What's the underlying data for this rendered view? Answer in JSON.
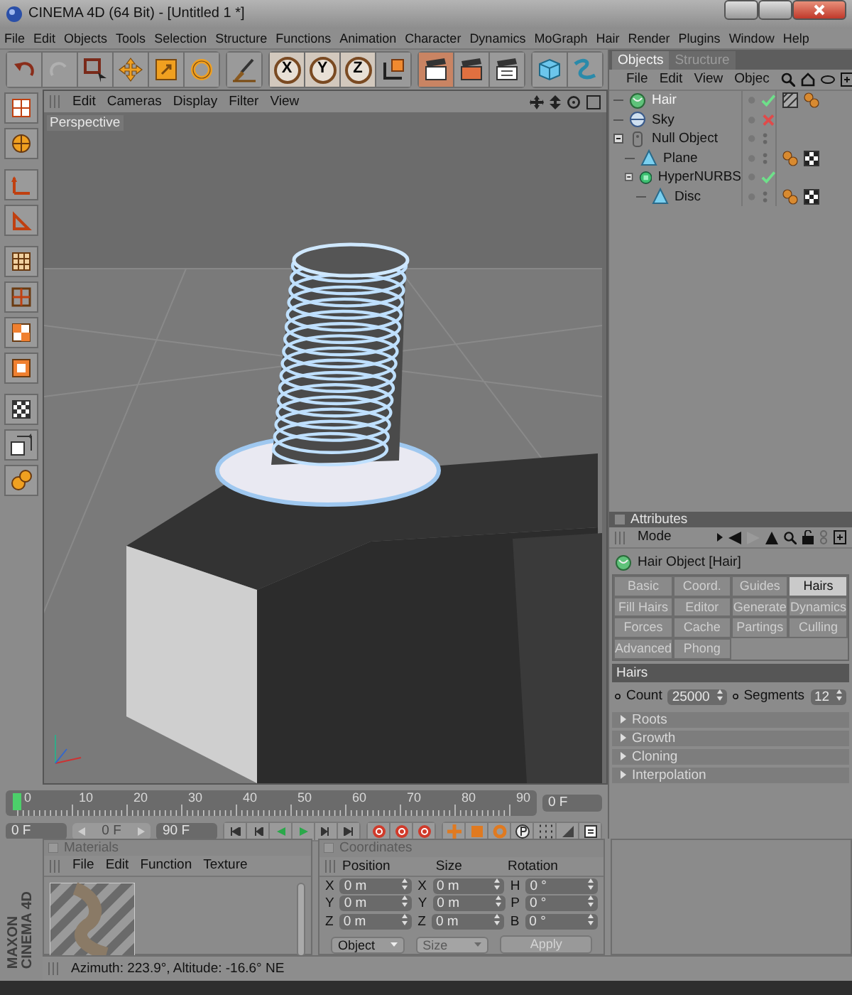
{
  "window": {
    "title": "CINEMA 4D (64 Bit) - [Untitled 1 *]"
  },
  "menu": [
    "File",
    "Edit",
    "Objects",
    "Tools",
    "Selection",
    "Structure",
    "Functions",
    "Animation",
    "Character",
    "Dynamics",
    "MoGraph",
    "Hair",
    "Render",
    "Plugins",
    "Window",
    "Help"
  ],
  "axis_buttons": [
    {
      "label": "X",
      "on": true
    },
    {
      "label": "Y",
      "on": true
    },
    {
      "label": "Z",
      "on": true
    }
  ],
  "viewport": {
    "menu": [
      "Edit",
      "Cameras",
      "Display",
      "Filter",
      "View"
    ],
    "camera": "Perspective"
  },
  "objects": {
    "tabs": [
      {
        "label": "Objects",
        "selected": true
      },
      {
        "label": "Structure",
        "selected": false
      }
    ],
    "menu": [
      "File",
      "Edit",
      "View",
      "Objec"
    ],
    "tree": [
      {
        "name": "Hair",
        "kind": "hair",
        "selected": true,
        "enabled": true,
        "tags": [
          {
            "kind": "hair-material"
          },
          {
            "kind": "phong"
          }
        ]
      },
      {
        "name": "Sky",
        "kind": "sky",
        "selected": false,
        "enabled": false
      },
      {
        "name": "Null Object",
        "kind": "null",
        "selected": false,
        "expanded": true,
        "children": [
          {
            "name": "Plane",
            "kind": "polygon",
            "selected": false,
            "tags": [
              {
                "kind": "phong"
              },
              {
                "kind": "checker"
              }
            ]
          },
          {
            "name": "HyperNURBS",
            "kind": "nurbs",
            "selected": false,
            "enabled": true,
            "expanded": true,
            "children": [
              {
                "name": "Disc",
                "kind": "polygon",
                "selected": false,
                "tags": [
                  {
                    "kind": "phong"
                  },
                  {
                    "kind": "checker"
                  }
                ]
              }
            ]
          }
        ]
      }
    ]
  },
  "attributes": {
    "title": "Attributes",
    "mode": "Mode",
    "object": "Hair Object [Hair]",
    "tabs": [
      {
        "label": "Basic",
        "selected": false
      },
      {
        "label": "Coord.",
        "selected": false
      },
      {
        "label": "Guides",
        "selected": false
      },
      {
        "label": "Hairs",
        "selected": true
      },
      {
        "label": "Fill Hairs",
        "selected": false
      },
      {
        "label": "Editor",
        "selected": false
      },
      {
        "label": "Generate",
        "selected": false
      },
      {
        "label": "Dynamics",
        "selected": false
      },
      {
        "label": "Forces",
        "selected": false
      },
      {
        "label": "Cache",
        "selected": false
      },
      {
        "label": "Partings",
        "selected": false
      },
      {
        "label": "Culling",
        "selected": false
      },
      {
        "label": "Advanced",
        "selected": false
      },
      {
        "label": "Phong",
        "selected": false
      }
    ],
    "section": "Hairs",
    "fields": [
      {
        "label": "Count",
        "value": "25000"
      },
      {
        "label": "Segments",
        "value": "12"
      }
    ],
    "groups": [
      {
        "label": "Roots",
        "expanded": false
      },
      {
        "label": "Growth",
        "expanded": false
      },
      {
        "label": "Cloning",
        "expanded": false
      },
      {
        "label": "Interpolation",
        "expanded": false
      }
    ]
  },
  "timeline": {
    "ticks": [
      "0",
      "10",
      "20",
      "30",
      "40",
      "50",
      "60",
      "70",
      "80",
      "90"
    ],
    "playhead": {
      "level": 0
    },
    "frame": "0 F",
    "start": "0 F",
    "preview": {
      "value": "0 F",
      "disabled": true
    },
    "end": "90 F"
  },
  "materials": {
    "title": "Materials",
    "menu": [
      "File",
      "Edit",
      "Function",
      "Texture"
    ]
  },
  "coordinates": {
    "title": "Coordinates",
    "headers": [
      "Position",
      "Size",
      "Rotation"
    ],
    "rows": [
      {
        "cells": [
          {
            "axis": "X",
            "value": "0 m"
          },
          {
            "axis": "X",
            "value": "0 m"
          },
          {
            "axis": "H",
            "value": "0 °"
          }
        ]
      },
      {
        "cells": [
          {
            "axis": "Y",
            "value": "0 m"
          },
          {
            "axis": "Y",
            "value": "0 m"
          },
          {
            "axis": "P",
            "value": "0 °"
          }
        ]
      },
      {
        "cells": [
          {
            "axis": "Z",
            "value": "0 m"
          },
          {
            "axis": "Z",
            "value": "0 m"
          },
          {
            "axis": "B",
            "value": "0 °"
          }
        ]
      }
    ],
    "dropdowns": [
      {
        "value": "Object",
        "disabled": false
      },
      {
        "value": "Size",
        "disabled": true
      }
    ],
    "apply": "Apply"
  },
  "status_bar": "Azimuth: 223.9°, Altitude: -16.6°  NE",
  "brand": [
    "MAXON",
    "CINEMA 4D"
  ]
}
